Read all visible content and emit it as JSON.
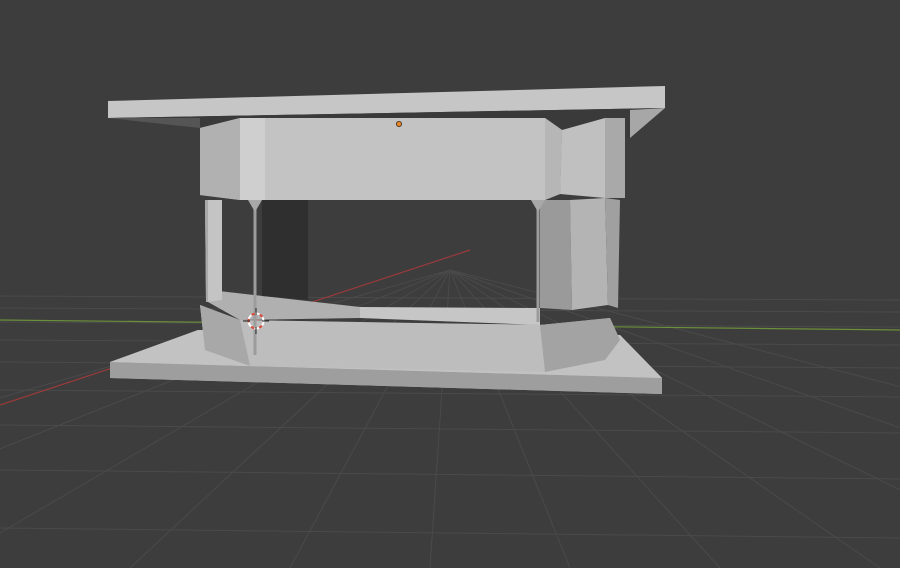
{
  "viewport": {
    "background": "#3d3d3d",
    "grid_color": "#4a4a4a",
    "grid_minor_color": "#434343",
    "x_axis_color": "#9a3a3a",
    "y_axis_color": "#6b8f3a"
  },
  "model": {
    "face_light": "#c9c9c9",
    "face_mid": "#b8b8b8",
    "face_dark": "#a3a3a3",
    "face_shadow": "#8e8e8e",
    "edge_color": "#8a8a8a"
  },
  "origin_point": {
    "color": "#e8862c",
    "icon": "object-origin-icon"
  },
  "cursor_3d": {
    "icon": "3d-cursor-icon",
    "ring_color": "#ffffff",
    "accent_color": "#d94b3b"
  }
}
